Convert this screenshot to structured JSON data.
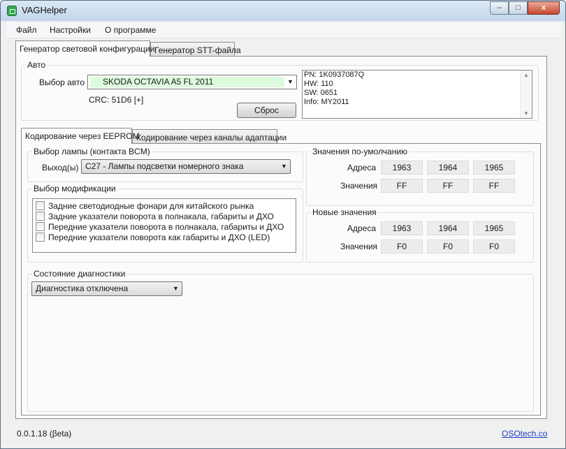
{
  "window": {
    "title": "VAGHelper",
    "controls": {
      "minimize": "–",
      "maximize": "□",
      "close": "x"
    }
  },
  "menu": [
    "Файл",
    "Настройки",
    "О программе"
  ],
  "main_tabs": [
    "Генератор световой конфигурации",
    "Генератор STT-файла"
  ],
  "auto": {
    "group_label": "Авто",
    "car_select_label": "Выбор авто",
    "car_value": "SKODA OCTAVIA A5 FL 2011",
    "crc": "CRC: 51D6 [+]",
    "reset_button": "Сброс",
    "info_lines": [
      "PN: 1K0937087Q",
      "HW: 110",
      "SW: 0651",
      "Info: MY2011"
    ],
    "accent_color": "#dcfbdc"
  },
  "sub_tabs": [
    "Кодирование через EEPROM",
    "Кодирование через каналы адаптации"
  ],
  "lamp": {
    "group_label": "Выбор лампы (контакта BCM)",
    "output_label": "Выход(ы)",
    "output_value": "C27 - Лампы подсветки номерного знака"
  },
  "modification": {
    "group_label": "Выбор модификации",
    "items": [
      "Задние светодиодные фонари для китайского рынка",
      "Задние указатели поворота в полнакала, габариты и ДХО",
      "Передние указатели поворота в полнакала, габариты и ДХО",
      "Передние указатели поворота как габариты и ДХО (LED)"
    ]
  },
  "defaults": {
    "group_label": "Значения по-умолчанию",
    "address_label": "Адреса",
    "values_label": "Значения",
    "addresses": [
      "1963",
      "1964",
      "1965"
    ],
    "values": [
      "FF",
      "FF",
      "FF"
    ]
  },
  "new_values": {
    "group_label": "Новые значения",
    "address_label": "Адреса",
    "values_label": "Значения",
    "addresses": [
      "1963",
      "1964",
      "1965"
    ],
    "values": [
      "F0",
      "F0",
      "F0"
    ]
  },
  "diagnostics": {
    "group_label": "Состояние диагностики",
    "value": "Диагностика отключена"
  },
  "status": {
    "version": "0.0.1.18 (βeta)",
    "link": "OSOtech.co"
  }
}
